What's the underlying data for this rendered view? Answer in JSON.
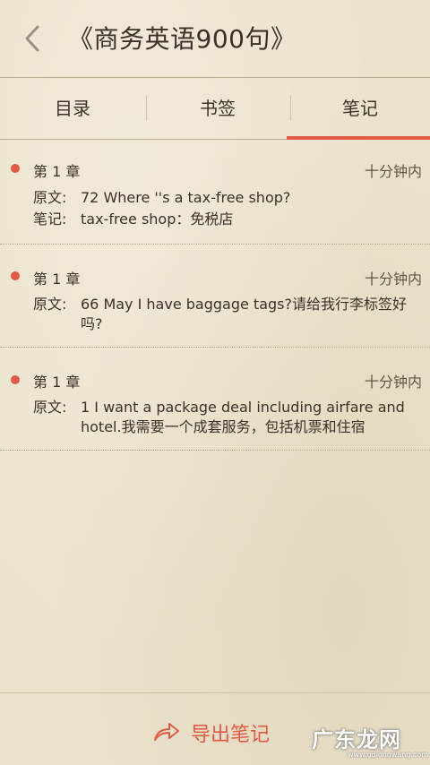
{
  "header": {
    "title": "《商务英语900句》"
  },
  "tabs": [
    {
      "label": "目录"
    },
    {
      "label": "书签"
    },
    {
      "label": "笔记"
    }
  ],
  "notes": [
    {
      "chapter": "第 1 章",
      "time": "十分钟内",
      "original_label": "原文:",
      "original": "72 Where ''s a tax-free shop?",
      "note_label": "笔记:",
      "note": "tax-free shop：免税店"
    },
    {
      "chapter": "第 1 章",
      "time": "十分钟内",
      "original_label": "原文:",
      "original": "66 May I have baggage tags?请给我行李标签好吗?"
    },
    {
      "chapter": "第 1 章",
      "time": "十分钟内",
      "original_label": "原文:",
      "original": "1 I want a package deal including airfare and hotel.我需要一个成套服务，包括机票和住宿"
    }
  ],
  "footer": {
    "export_label": "导出笔记"
  },
  "watermark": {
    "text": "广东龙网",
    "subtext": "www.gdlongwang.com"
  },
  "colors": {
    "accent": "#e05a45",
    "background": "#ece3cd"
  }
}
